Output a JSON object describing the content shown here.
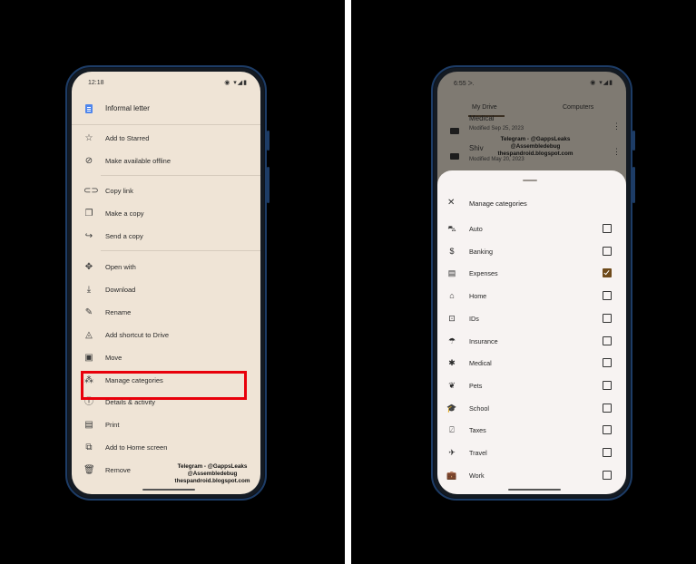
{
  "left_phone": {
    "status": {
      "time": "12:18",
      "icons": "◉ ▾◢▮"
    },
    "document": {
      "title": "Informal letter",
      "icon": "docs-icon"
    },
    "menu": [
      {
        "label": "Add to Starred",
        "icon": "star-icon",
        "glyph": "☆"
      },
      {
        "label": "Make available offline",
        "icon": "offline-icon",
        "glyph": "⊘"
      },
      {
        "label": "Copy link",
        "icon": "link-icon",
        "glyph": "⊂⊃"
      },
      {
        "label": "Make a copy",
        "icon": "copy-icon",
        "glyph": "❐"
      },
      {
        "label": "Send a copy",
        "icon": "share-icon",
        "glyph": "↪"
      },
      {
        "label": "Open with",
        "icon": "open-with-icon",
        "glyph": "✥"
      },
      {
        "label": "Download",
        "icon": "download-icon",
        "glyph": "⤓"
      },
      {
        "label": "Rename",
        "icon": "rename-icon",
        "glyph": "✎"
      },
      {
        "label": "Add shortcut to Drive",
        "icon": "shortcut-icon",
        "glyph": "◬"
      },
      {
        "label": "Move",
        "icon": "move-icon",
        "glyph": "▣"
      },
      {
        "label": "Manage categories",
        "icon": "categories-icon",
        "glyph": "⁂"
      },
      {
        "label": "Details & activity",
        "icon": "info-icon",
        "glyph": "ⓘ"
      },
      {
        "label": "Print",
        "icon": "print-icon",
        "glyph": "▤"
      },
      {
        "label": "Add to Home screen",
        "icon": "add-home-icon",
        "glyph": "⧉"
      },
      {
        "label": "Remove",
        "icon": "trash-icon",
        "glyph": "🗑"
      }
    ],
    "watermark": [
      "Telegram - @GappsLeaks",
      "@Assembledebug",
      "thespandroid.blogspot.com"
    ]
  },
  "right_phone": {
    "status": {
      "time": "6:55  ᐳ.",
      "icons": "◉ ▾◢▮"
    },
    "tabs": {
      "my_drive": "My Drive",
      "computers": "Computers"
    },
    "files": [
      {
        "name": "Medical",
        "modified": "Modified Sep 25, 2023"
      },
      {
        "name": "Shiv",
        "modified": "Modified May 20, 2023"
      }
    ],
    "watermark": [
      "Telegram - @GappsLeaks",
      "@Assembledebug",
      "thespandroid.blogspot.com"
    ],
    "sheet": {
      "title": "Manage categories",
      "close_icon": "close-icon",
      "categories": [
        {
          "label": "Auto",
          "icon": "car-icon",
          "glyph": "⛍",
          "checked": false
        },
        {
          "label": "Banking",
          "icon": "dollar-icon",
          "glyph": "$",
          "checked": false
        },
        {
          "label": "Expenses",
          "icon": "receipt-icon",
          "glyph": "▤",
          "checked": true
        },
        {
          "label": "Home",
          "icon": "home-icon",
          "glyph": "⌂",
          "checked": false
        },
        {
          "label": "IDs",
          "icon": "id-card-icon",
          "glyph": "⊡",
          "checked": false
        },
        {
          "label": "Insurance",
          "icon": "umbrella-icon",
          "glyph": "☂",
          "checked": false
        },
        {
          "label": "Medical",
          "icon": "asterisk-icon",
          "glyph": "✱",
          "checked": false
        },
        {
          "label": "Pets",
          "icon": "paw-icon",
          "glyph": "❦",
          "checked": false
        },
        {
          "label": "School",
          "icon": "school-icon",
          "glyph": "🎓",
          "checked": false
        },
        {
          "label": "Taxes",
          "icon": "tax-icon",
          "glyph": "⍁",
          "checked": false
        },
        {
          "label": "Travel",
          "icon": "plane-icon",
          "glyph": "✈",
          "checked": false
        },
        {
          "label": "Work",
          "icon": "briefcase-icon",
          "glyph": "💼",
          "checked": false
        }
      ]
    }
  }
}
